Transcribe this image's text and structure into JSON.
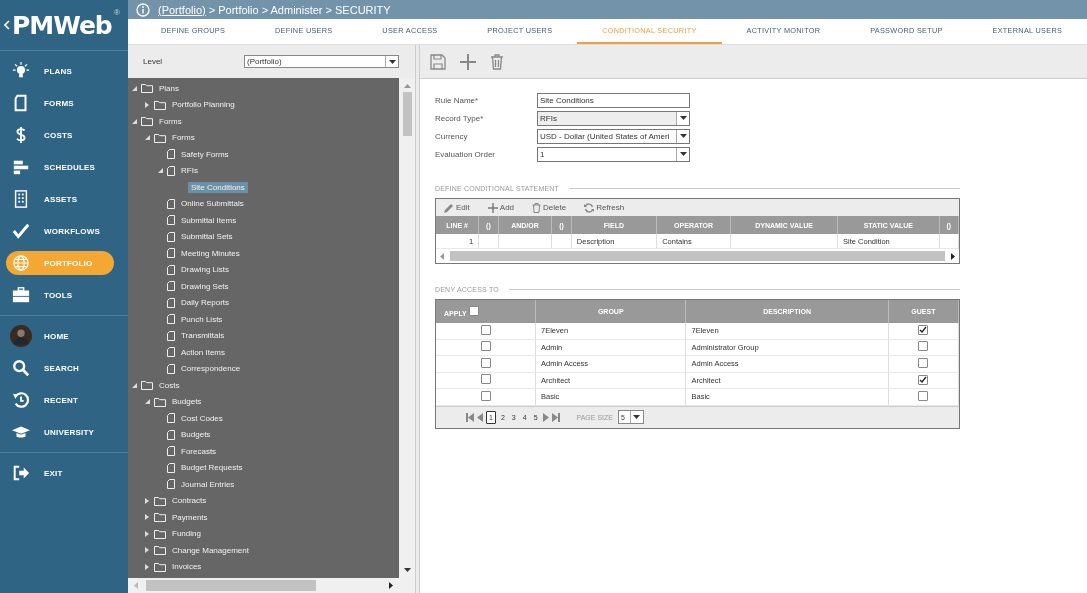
{
  "logo": {
    "text": "PMWeb",
    "mark": "®"
  },
  "breadcrumb": [
    {
      "kind": "link",
      "text": "(Portfolio)"
    },
    {
      "kind": "text",
      "text": "> Portfolio > Administer > SECURITY"
    }
  ],
  "nav_groups": [
    [
      {
        "label": "PLANS",
        "selected": false
      },
      {
        "label": "FORMS",
        "selected": false
      },
      {
        "label": "COSTS",
        "selected": false
      },
      {
        "label": "SCHEDULES",
        "selected": false
      },
      {
        "label": "ASSETS",
        "selected": false
      },
      {
        "label": "WORKFLOWS",
        "selected": false
      },
      {
        "label": "PORTFOLIO",
        "selected": true
      },
      {
        "label": "TOOLS",
        "selected": false
      }
    ],
    [
      {
        "label": "HOME",
        "selected": false
      },
      {
        "label": "SEARCH",
        "selected": false
      },
      {
        "label": "RECENT",
        "selected": false
      },
      {
        "label": "UNIVERSITY",
        "selected": false
      }
    ],
    [
      {
        "label": "EXIT",
        "selected": false
      }
    ]
  ],
  "tabs": [
    {
      "label": "DEFINE GROUPS",
      "selected": false
    },
    {
      "label": "DEFINE USERS",
      "selected": false
    },
    {
      "label": "USER ACCESS",
      "selected": false
    },
    {
      "label": "PROJECT USERS",
      "selected": false
    },
    {
      "label": "CONDITIONAL SECURITY",
      "selected": true
    },
    {
      "label": "ACTIVITY MONITOR",
      "selected": false
    },
    {
      "label": "PASSWORD SETUP",
      "selected": false
    },
    {
      "label": "EXTERNAL USERS",
      "selected": false
    }
  ],
  "level": {
    "label": "Level",
    "value": "(Portfolio)"
  },
  "tree": [
    {
      "label": "Plans",
      "kind": "folder",
      "expanded": true,
      "selected": false,
      "children": [
        {
          "label": "Portfolio Planning",
          "kind": "folder",
          "expanded": false,
          "selected": false
        }
      ]
    },
    {
      "label": "Forms",
      "kind": "folder",
      "expanded": true,
      "selected": false,
      "children": [
        {
          "label": "Forms",
          "kind": "folder",
          "expanded": true,
          "selected": false,
          "children": [
            {
              "label": "Safety Forms",
              "kind": "form",
              "selected": false
            },
            {
              "label": "RFIs",
              "kind": "form",
              "expanded": true,
              "selected": false,
              "children": [
                {
                  "label": "Site Conditions",
                  "kind": "rule",
                  "selected": true
                }
              ]
            },
            {
              "label": "Online Submittals",
              "kind": "form",
              "selected": false
            },
            {
              "label": "Submittal Items",
              "kind": "form",
              "selected": false
            },
            {
              "label": "Submittal Sets",
              "kind": "form",
              "selected": false
            },
            {
              "label": "Meeting Minutes",
              "kind": "form",
              "selected": false
            },
            {
              "label": "Drawing Lists",
              "kind": "form",
              "selected": false
            },
            {
              "label": "Drawing Sets",
              "kind": "form",
              "selected": false
            },
            {
              "label": "Daily Reports",
              "kind": "form",
              "selected": false
            },
            {
              "label": "Punch Lists",
              "kind": "form",
              "selected": false
            },
            {
              "label": "Transmittals",
              "kind": "form",
              "selected": false
            },
            {
              "label": "Action Items",
              "kind": "form",
              "selected": false
            },
            {
              "label": "Correspondence",
              "kind": "form",
              "selected": false
            }
          ]
        }
      ]
    },
    {
      "label": "Costs",
      "kind": "folder",
      "expanded": true,
      "selected": false,
      "children": [
        {
          "label": "Budgets",
          "kind": "folder",
          "expanded": true,
          "selected": false,
          "children": [
            {
              "label": "Cost Codes",
              "kind": "form",
              "selected": false
            },
            {
              "label": "Budgets",
              "kind": "form",
              "selected": false
            },
            {
              "label": "Forecasts",
              "kind": "form",
              "selected": false
            },
            {
              "label": "Budget Requests",
              "kind": "form",
              "selected": false
            },
            {
              "label": "Journal Entries",
              "kind": "form",
              "selected": false
            }
          ]
        },
        {
          "label": "Contracts",
          "kind": "folder",
          "expanded": false,
          "selected": false
        },
        {
          "label": "Payments",
          "kind": "folder",
          "expanded": false,
          "selected": false
        },
        {
          "label": "Funding",
          "kind": "folder",
          "expanded": false,
          "selected": false
        },
        {
          "label": "Change Management",
          "kind": "folder",
          "expanded": false,
          "selected": false
        },
        {
          "label": "Invoices",
          "kind": "folder",
          "expanded": false,
          "selected": false
        }
      ]
    }
  ],
  "form_fields": [
    {
      "label": "Rule Name*",
      "value": "Site Conditions",
      "kind": "text",
      "disabled": false
    },
    {
      "label": "Record Type*",
      "value": "RFIs",
      "kind": "select",
      "disabled": true
    },
    {
      "label": "Currency",
      "value": "USD - Dollar (United States of Ameri",
      "kind": "select",
      "disabled": false
    },
    {
      "label": "Evaluation Order",
      "value": "1",
      "kind": "select",
      "disabled": false
    }
  ],
  "conditions": {
    "title": "DEFINE CONDITIONAL STATEMENT",
    "actions": [
      {
        "label": "Edit"
      },
      {
        "label": "Add"
      },
      {
        "label": "Delete"
      },
      {
        "label": "Refresh"
      }
    ],
    "columns": [
      "LINE #",
      "()",
      "AND/OR",
      "()",
      "FIELD",
      "OPERATOR",
      "DYNAMIC VALUE",
      "STATIC VALUE",
      "()"
    ],
    "rows": [
      [
        "1",
        "",
        "",
        "",
        "Description",
        "Contains",
        "",
        "Site Condition",
        ""
      ]
    ]
  },
  "deny": {
    "title": "DENY ACCESS TO",
    "apply_label": "APPLY",
    "apply_all": false,
    "columns": [
      "GROUP",
      "DESCRIPTION",
      "GUEST"
    ],
    "rows": [
      {
        "group": "7Eleven",
        "description": "7Eleven",
        "apply": false,
        "guest": true
      },
      {
        "group": "Admin",
        "description": "Administrator Group",
        "apply": false,
        "guest": false
      },
      {
        "group": "Admin Access",
        "description": "Admin Access",
        "apply": false,
        "guest": false
      },
      {
        "group": "Architect",
        "description": "Architect",
        "apply": false,
        "guest": true
      },
      {
        "group": "Basic",
        "description": "Basic",
        "apply": false,
        "guest": false
      }
    ],
    "pages": [
      {
        "label": "1",
        "selected": true
      },
      {
        "label": "2",
        "selected": false
      },
      {
        "label": "3",
        "selected": false
      },
      {
        "label": "4",
        "selected": false
      },
      {
        "label": "5",
        "selected": false
      }
    ],
    "page_size_label": "PAGE SIZE",
    "page_size": "5"
  }
}
